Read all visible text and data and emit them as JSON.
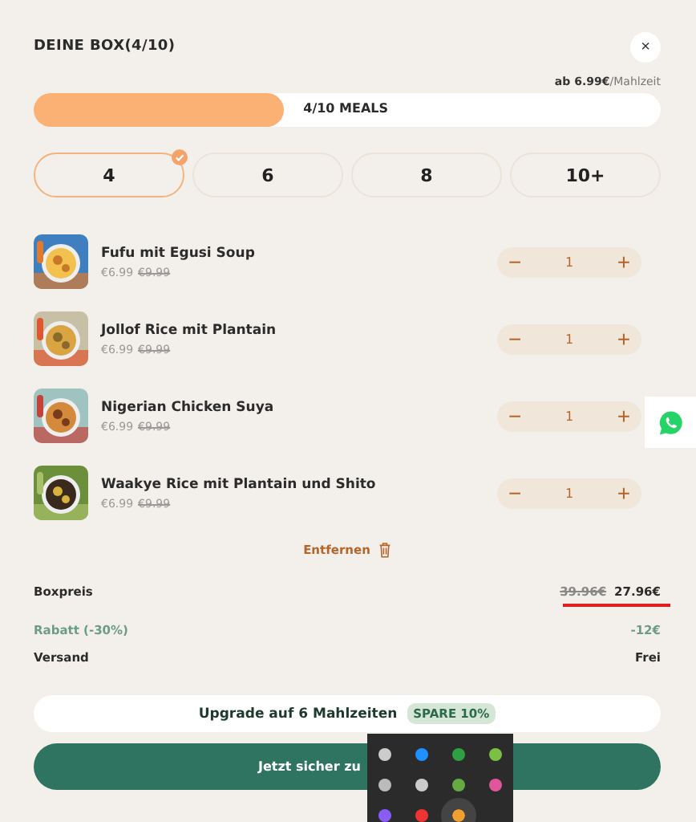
{
  "header": {
    "title": "DEINE BOX(4/10)",
    "close": "×"
  },
  "price_hint": {
    "bold": "ab 6.99€",
    "rest": "/Mahlzeit"
  },
  "progress": {
    "label": "4/10 MEALS",
    "level": 0.4
  },
  "sizes": [
    {
      "label": "4",
      "selected": true
    },
    {
      "label": "6",
      "selected": false
    },
    {
      "label": "8",
      "selected": false
    },
    {
      "label": "10+",
      "selected": false
    }
  ],
  "items": [
    {
      "name": "Fufu mit Egusi Soup",
      "price": "€6.99",
      "old_price": "€9.99",
      "quantity": "1",
      "minus": "−",
      "plus": "+"
    },
    {
      "name": "Jollof Rice mit Plantain",
      "price": "€6.99",
      "old_price": "€9.99",
      "quantity": "1",
      "minus": "−",
      "plus": "+"
    },
    {
      "name": "Nigerian Chicken Suya",
      "price": "€6.99",
      "old_price": "€9.99",
      "quantity": "1",
      "minus": "−",
      "plus": "+"
    },
    {
      "name": "Waakye Rice mit Plantain und Shito",
      "price": "€6.99",
      "old_price": "€9.99",
      "quantity": "1",
      "minus": "−",
      "plus": "+"
    }
  ],
  "remove": "Entfernen",
  "summary": [
    {
      "kind": "boxprice",
      "label": "Boxpreis",
      "old_value": "39.96€",
      "value": "27.96€"
    },
    {
      "kind": "discount",
      "label": "Rabatt (-30%)",
      "value": "-12€"
    },
    {
      "kind": "plain",
      "label": "Versand",
      "value": "Frei"
    }
  ],
  "upgrade": {
    "label": "Upgrade auf 6 Mahlzeiten",
    "badge": "SPARE 10%"
  },
  "checkout": {
    "label": "Jetzt sicher zu"
  }
}
